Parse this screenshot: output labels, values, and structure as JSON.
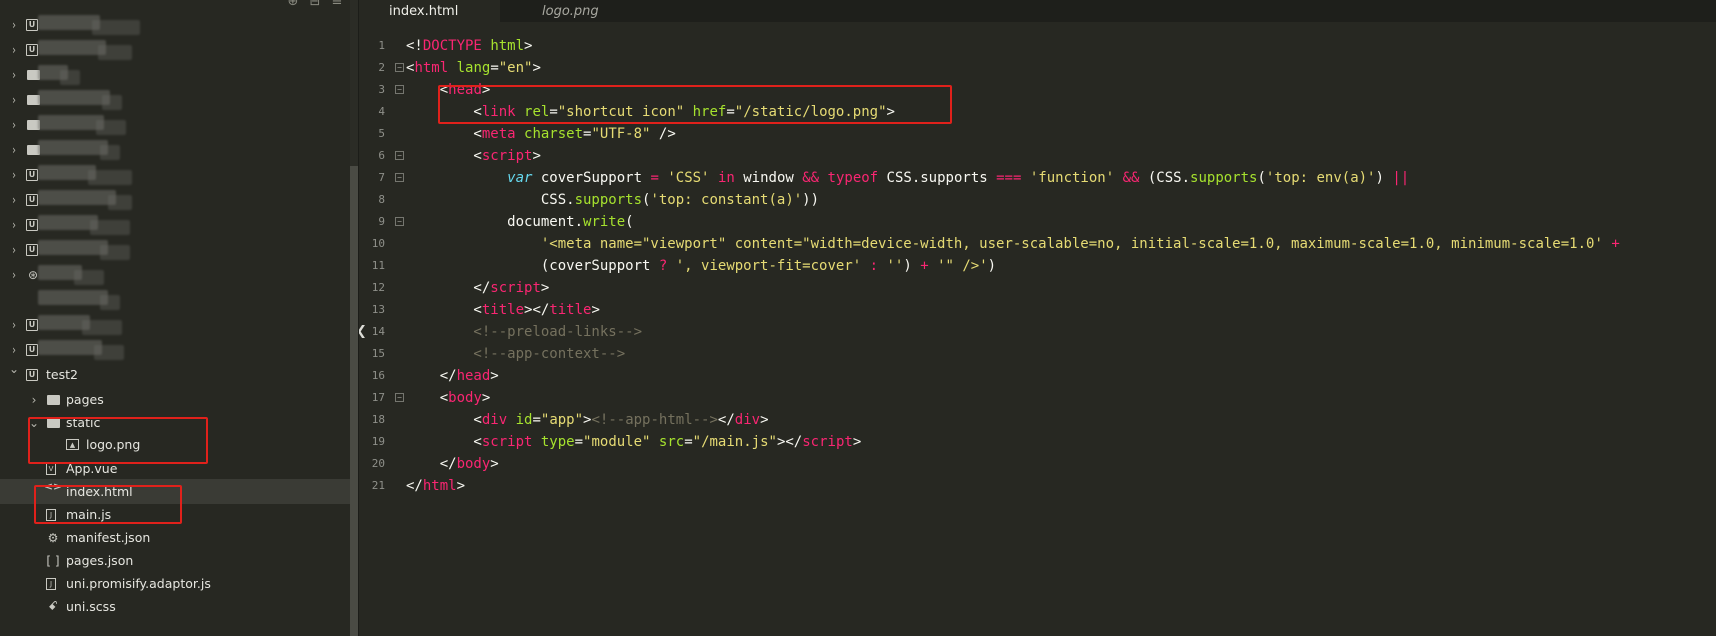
{
  "sidebar": {
    "toolbar_icons": [
      "new-file-icon",
      "collapse-all-icon",
      "menu-icon"
    ],
    "hidden_projects_count": 14,
    "project": {
      "name": "test2",
      "children": [
        {
          "label": "pages",
          "type": "folder",
          "expanded": false
        },
        {
          "label": "static",
          "type": "folder",
          "expanded": true
        },
        {
          "label": "logo.png",
          "type": "image",
          "nested": true
        },
        {
          "label": "App.vue",
          "type": "vue"
        },
        {
          "label": "index.html",
          "type": "html",
          "selected": true
        },
        {
          "label": "main.js",
          "type": "js"
        },
        {
          "label": "manifest.json",
          "type": "gear-json"
        },
        {
          "label": "pages.json",
          "type": "brackets-json"
        },
        {
          "label": "uni.promisify.adaptor.js",
          "type": "js"
        },
        {
          "label": "uni.scss",
          "type": "scss"
        }
      ]
    }
  },
  "tabs": [
    {
      "label": "index.html",
      "active": true
    },
    {
      "label": "logo.png",
      "active": false
    }
  ],
  "editor": {
    "line_numbers": [
      "1",
      "2",
      "3",
      "4",
      "5",
      "6",
      "7",
      "8",
      "9",
      "10",
      "11",
      "12",
      "13",
      "14",
      "15",
      "16",
      "17",
      "18",
      "19",
      "20",
      "21"
    ],
    "lines": [
      [
        [
          "c-plain",
          "<!"
        ],
        [
          "c-tag",
          "DOCTYPE"
        ],
        [
          "c-plain",
          " "
        ],
        [
          "c-attr",
          "html"
        ],
        [
          "c-plain",
          ">"
        ]
      ],
      [
        [
          "c-plain",
          "<"
        ],
        [
          "c-tag",
          "html"
        ],
        [
          "c-plain",
          " "
        ],
        [
          "c-attr",
          "lang"
        ],
        [
          "c-plain",
          "="
        ],
        [
          "c-str",
          "\"en\""
        ],
        [
          "c-plain",
          ">"
        ]
      ],
      [
        [
          "c-plain",
          "    <"
        ],
        [
          "c-tag",
          "head"
        ],
        [
          "c-plain",
          ">"
        ]
      ],
      [
        [
          "c-plain",
          "        <"
        ],
        [
          "c-tag",
          "link"
        ],
        [
          "c-plain",
          " "
        ],
        [
          "c-attr",
          "rel"
        ],
        [
          "c-plain",
          "="
        ],
        [
          "c-str",
          "\"shortcut icon\""
        ],
        [
          "c-plain",
          " "
        ],
        [
          "c-attr",
          "href"
        ],
        [
          "c-plain",
          "="
        ],
        [
          "c-str",
          "\"/static/logo.png\""
        ],
        [
          "c-plain",
          ">"
        ]
      ],
      [
        [
          "c-plain",
          "        <"
        ],
        [
          "c-tag",
          "meta"
        ],
        [
          "c-plain",
          " "
        ],
        [
          "c-attr",
          "charset"
        ],
        [
          "c-plain",
          "="
        ],
        [
          "c-str",
          "\"UTF-8\""
        ],
        [
          "c-plain",
          " />"
        ]
      ],
      [
        [
          "c-plain",
          "        <"
        ],
        [
          "c-tag",
          "script"
        ],
        [
          "c-plain",
          ">"
        ]
      ],
      [
        [
          "c-plain",
          "            "
        ],
        [
          "c-kw",
          "var"
        ],
        [
          "c-plain",
          " coverSupport "
        ],
        [
          "c-op",
          "="
        ],
        [
          "c-plain",
          " "
        ],
        [
          "c-str",
          "'CSS'"
        ],
        [
          "c-plain",
          " "
        ],
        [
          "c-op",
          "in"
        ],
        [
          "c-plain",
          " window "
        ],
        [
          "c-op",
          "&&"
        ],
        [
          "c-plain",
          " "
        ],
        [
          "c-op",
          "typeof"
        ],
        [
          "c-plain",
          " CSS.supports "
        ],
        [
          "c-op",
          "==="
        ],
        [
          "c-plain",
          " "
        ],
        [
          "c-str",
          "'function'"
        ],
        [
          "c-plain",
          " "
        ],
        [
          "c-op",
          "&&"
        ],
        [
          "c-plain",
          " (CSS."
        ],
        [
          "c-fn",
          "supports"
        ],
        [
          "c-plain",
          "("
        ],
        [
          "c-str",
          "'top: env(a)'"
        ],
        [
          "c-plain",
          ") "
        ],
        [
          "c-op",
          "||"
        ]
      ],
      [
        [
          "c-plain",
          "                CSS."
        ],
        [
          "c-fn",
          "supports"
        ],
        [
          "c-plain",
          "("
        ],
        [
          "c-str",
          "'top: constant(a)'"
        ],
        [
          "c-plain",
          "))"
        ]
      ],
      [
        [
          "c-plain",
          "            document."
        ],
        [
          "c-fn",
          "write"
        ],
        [
          "c-plain",
          "("
        ]
      ],
      [
        [
          "c-plain",
          "                "
        ],
        [
          "c-str",
          "'<meta name=\"viewport\" content=\"width=device-width, user-scalable=no, initial-scale=1.0, maximum-scale=1.0, minimum-scale=1.0'"
        ],
        [
          "c-plain",
          " "
        ],
        [
          "c-op",
          "+"
        ]
      ],
      [
        [
          "c-plain",
          "                (coverSupport "
        ],
        [
          "c-op",
          "?"
        ],
        [
          "c-plain",
          " "
        ],
        [
          "c-str",
          "', viewport-fit=cover'"
        ],
        [
          "c-plain",
          " "
        ],
        [
          "c-op",
          ":"
        ],
        [
          "c-plain",
          " "
        ],
        [
          "c-str",
          "''"
        ],
        [
          "c-plain",
          ") "
        ],
        [
          "c-op",
          "+"
        ],
        [
          "c-plain",
          " "
        ],
        [
          "c-str",
          "'\" />'"
        ],
        [
          "c-plain",
          ")"
        ]
      ],
      [
        [
          "c-plain",
          "        </"
        ],
        [
          "c-tag",
          "script"
        ],
        [
          "c-plain",
          ">"
        ]
      ],
      [
        [
          "c-plain",
          "        <"
        ],
        [
          "c-tag",
          "title"
        ],
        [
          "c-plain",
          "></"
        ],
        [
          "c-tag",
          "title"
        ],
        [
          "c-plain",
          ">"
        ]
      ],
      [
        [
          "c-cmt",
          "        <!--preload-links-->"
        ]
      ],
      [
        [
          "c-cmt",
          "        <!--app-context-->"
        ]
      ],
      [
        [
          "c-plain",
          "    </"
        ],
        [
          "c-tag",
          "head"
        ],
        [
          "c-plain",
          ">"
        ]
      ],
      [
        [
          "c-plain",
          "    <"
        ],
        [
          "c-tag",
          "body"
        ],
        [
          "c-plain",
          ">"
        ]
      ],
      [
        [
          "c-plain",
          "        <"
        ],
        [
          "c-tag",
          "div"
        ],
        [
          "c-plain",
          " "
        ],
        [
          "c-attr",
          "id"
        ],
        [
          "c-plain",
          "="
        ],
        [
          "c-str",
          "\"app\""
        ],
        [
          "c-plain",
          ">"
        ],
        [
          "c-cmt",
          "<!--app-html-->"
        ],
        [
          "c-plain",
          "</"
        ],
        [
          "c-tag",
          "div"
        ],
        [
          "c-plain",
          ">"
        ]
      ],
      [
        [
          "c-plain",
          "        <"
        ],
        [
          "c-tag",
          "script"
        ],
        [
          "c-plain",
          " "
        ],
        [
          "c-attr",
          "type"
        ],
        [
          "c-plain",
          "="
        ],
        [
          "c-str",
          "\"module\""
        ],
        [
          "c-plain",
          " "
        ],
        [
          "c-attr",
          "src"
        ],
        [
          "c-plain",
          "="
        ],
        [
          "c-str",
          "\"/main.js\""
        ],
        [
          "c-plain",
          "></"
        ],
        [
          "c-tag",
          "script"
        ],
        [
          "c-plain",
          ">"
        ]
      ],
      [
        [
          "c-plain",
          "    </"
        ],
        [
          "c-tag",
          "body"
        ],
        [
          "c-plain",
          ">"
        ]
      ],
      [
        [
          "c-plain",
          "</"
        ],
        [
          "c-tag",
          "html"
        ],
        [
          "c-plain",
          ">"
        ]
      ]
    ],
    "fold_markers": [
      "2",
      "3",
      "6",
      "7",
      "9",
      "17"
    ]
  }
}
